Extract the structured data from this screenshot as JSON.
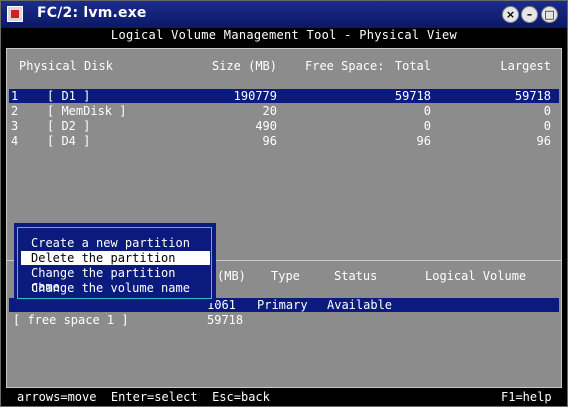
{
  "window": {
    "title": "FC/2: lvm.exe"
  },
  "header": "Logical Volume Management Tool - Physical View",
  "disk_table": {
    "headers": {
      "physical_disk": "Physical Disk",
      "size": "Size (MB)",
      "free_space": "Free Space:",
      "total": "Total",
      "largest": "Largest"
    },
    "rows": [
      {
        "num": "1",
        "name": "[ D1 ]",
        "size": "190779",
        "total": "59718",
        "largest": "59718",
        "selected": true
      },
      {
        "num": "2",
        "name": "[ MemDisk ]",
        "size": "20",
        "total": "0",
        "largest": "0",
        "selected": false
      },
      {
        "num": "3",
        "name": "[ D2 ]",
        "size": "490",
        "total": "0",
        "largest": "0",
        "selected": false
      },
      {
        "num": "4",
        "name": "[ D4 ]",
        "size": "96",
        "total": "96",
        "largest": "96",
        "selected": false
      }
    ]
  },
  "partition_table": {
    "headers": {
      "size": "(MB)",
      "type": "Type",
      "status": "Status",
      "logical_volume": "Logical Volume"
    },
    "rows": [
      {
        "name": "",
        "size": "1061",
        "type": "Primary",
        "status": "Available",
        "selected": true
      },
      {
        "name": "[ free space 1 ]",
        "size": "59718",
        "type": "",
        "status": "",
        "selected": false
      }
    ]
  },
  "context_menu": {
    "items": [
      {
        "label": "Create a new partition",
        "selected": false
      },
      {
        "label": "Delete the partition",
        "selected": true
      },
      {
        "label": "Change the partition name",
        "selected": false
      },
      {
        "label": "Change the volume name",
        "selected": false
      }
    ]
  },
  "footer": {
    "hints": "arrows=move  Enter=select  Esc=back",
    "help": "F1=help"
  },
  "colors": {
    "titlebar": "#0c1866",
    "selection": "#0a1b7d",
    "panel": "#8c8c8c",
    "menu_border": "#34bfd6"
  }
}
